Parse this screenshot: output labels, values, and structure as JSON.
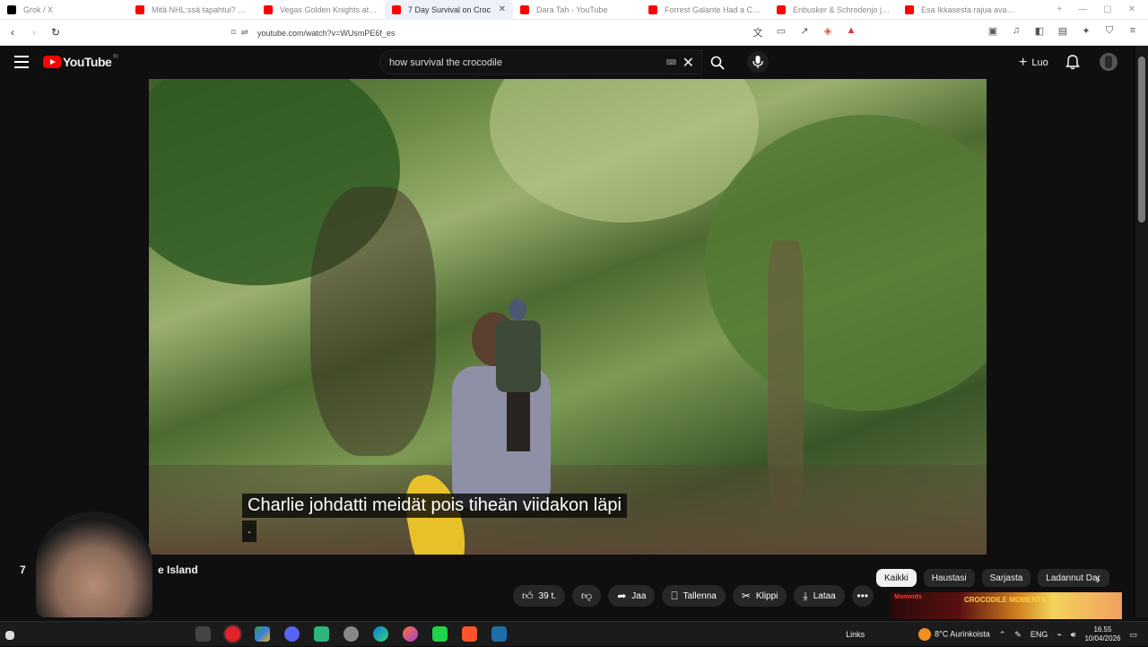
{
  "browser": {
    "tabs": [
      {
        "title": "Grok / X",
        "color": "#000000",
        "active": false
      },
      {
        "title": "Mitä NHL:ssä tapahtui? Kaikki",
        "color": "#ff0000",
        "active": false
      },
      {
        "title": "Vegas Golden Knights at Seattle",
        "color": "#ff0000",
        "active": false
      },
      {
        "title": "7 Day Survival on Croc",
        "color": "#ff0000",
        "active": true
      },
      {
        "title": "Dara Tah - YouTube",
        "color": "#ff0000",
        "active": false
      },
      {
        "title": "Forrest Galante Had a Close C",
        "color": "#ff0000",
        "active": false
      },
      {
        "title": "Enbusker & Schrodenjo jakso",
        "color": "#ff0000",
        "active": false
      },
      {
        "title": "Esa Ikkasesta rajua avautumm",
        "color": "#ff0000",
        "active": false
      }
    ],
    "url": "youtube.com/watch?v=WUsmPE6f_es"
  },
  "youtube": {
    "logo_text": "YouTube",
    "region": "FI",
    "search_value": "how survival the crocodile",
    "create_label": "Luo"
  },
  "video": {
    "caption_line1": "Charlie johdatti meidät pois tiheän viidakon läpi",
    "caption_line2": ".",
    "title_left": "7",
    "title_right": "e Island"
  },
  "actions": {
    "likes": "39 t.",
    "share": "Jaa",
    "save": "Tallenna",
    "clip": "Klippi",
    "download": "Lataa"
  },
  "chips": [
    "Kaikki",
    "Haustasi",
    "Sarjasta",
    "Ladannut Dar"
  ],
  "thumb": {
    "line1": "Moments",
    "line2": "CROCODILE MOMENTS"
  },
  "taskbar": {
    "links": "Links",
    "weather": "8°C  Aurinkoista",
    "lang": "ENG",
    "time": "16.55",
    "date": "10/04/2026"
  }
}
